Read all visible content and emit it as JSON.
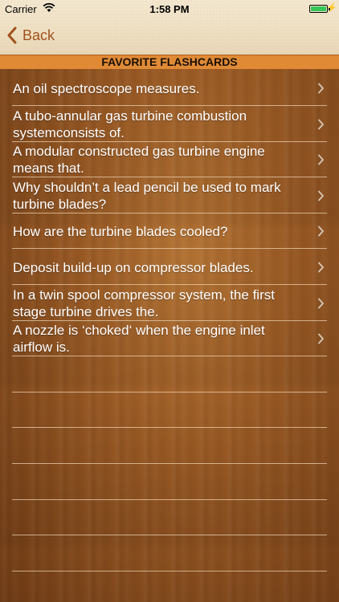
{
  "status_bar": {
    "carrier": "Carrier",
    "time": "1:58 PM",
    "battery_level_percent": 100
  },
  "nav": {
    "back_label": "Back"
  },
  "header": {
    "title": "FAVORITE FLASHCARDS"
  },
  "colors": {
    "accent": "#a0521d",
    "header_bg": "#e08a36",
    "row_text": "#ffffff",
    "battery": "#35c759"
  },
  "items": [
    {
      "label": "An oil spectroscope measures."
    },
    {
      "label": "A tubo-annular gas turbine combustion systemconsists of."
    },
    {
      "label": "A modular constructed gas turbine engine means that."
    },
    {
      "label": " Why shouldn’t a lead pencil be used to mark turbine blades?"
    },
    {
      "label": "How are the turbine blades cooled?"
    },
    {
      "label": "Deposit build-up on compressor blades."
    },
    {
      "label": "In a twin spool compressor system, the first stage turbine drives the."
    },
    {
      "label": "A nozzle is ‘choked‘ when the engine inlet airflow is."
    }
  ],
  "empty_rows": 6
}
